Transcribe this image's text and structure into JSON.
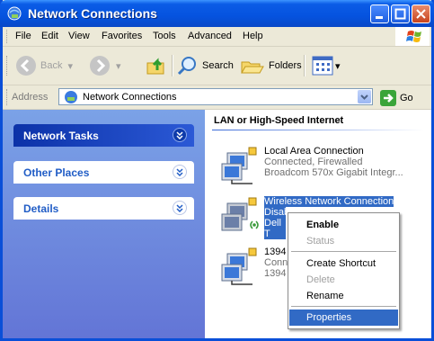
{
  "window": {
    "title": "Network Connections"
  },
  "menu": {
    "items": [
      "File",
      "Edit",
      "View",
      "Favorites",
      "Tools",
      "Advanced",
      "Help"
    ]
  },
  "toolbar": {
    "back": "Back",
    "search": "Search",
    "folders": "Folders"
  },
  "address": {
    "label": "Address",
    "value": "Network Connections",
    "go": "Go"
  },
  "tasks": {
    "groups": [
      "Network Tasks",
      "Other Places",
      "Details"
    ]
  },
  "content": {
    "section_title": "LAN or High-Speed Internet",
    "connections": [
      {
        "name": "Local Area Connection",
        "status": "Connected, Firewalled",
        "device": "Broadcom 570x Gigabit Integr..."
      },
      {
        "name": "Wireless Network Connection",
        "status": "Disabl",
        "device": "Dell T"
      },
      {
        "name": "1394",
        "status": "Conn",
        "device": "1394"
      }
    ]
  },
  "context_menu": {
    "items": [
      "Enable",
      "Status",
      "Create Shortcut",
      "Delete",
      "Rename",
      "Properties"
    ]
  },
  "colors": {
    "title_bar": "#0553df",
    "task_pane": "#6d8ce0",
    "selection": "#316ac5"
  }
}
